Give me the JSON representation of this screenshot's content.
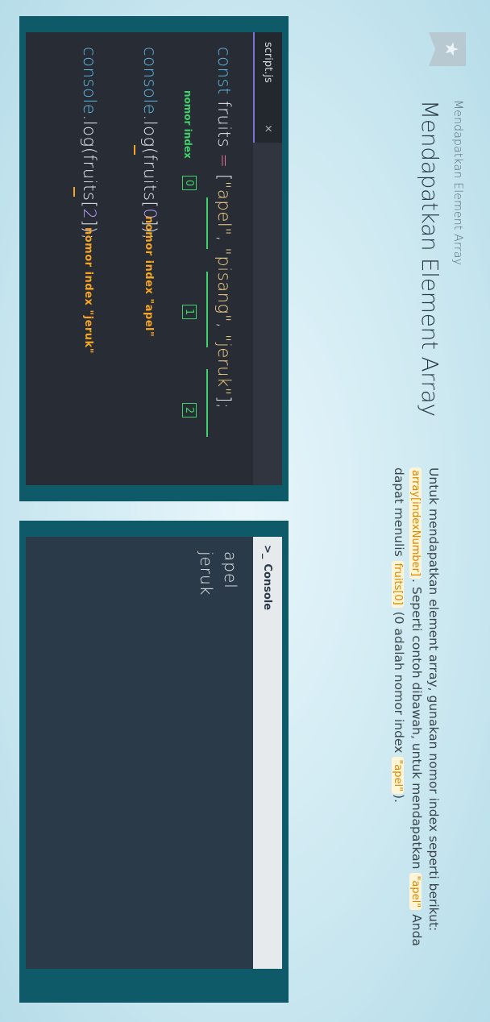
{
  "header": {
    "breadcrumb": "Mendapatkan Element Array",
    "title": "Mendapatkan Element Array"
  },
  "description": {
    "part1": "Untuk mendapatkan element array, gunakan nomor index seperti berikut: ",
    "code1": "array[indexNumber]",
    "part2": ". Seperti contoh dibawah, untuk mendapatkan ",
    "code2": "\"apel\"",
    "part3": " Anda dapat menulis ",
    "code3": "fruits[0]",
    "part4": " (0 adalah nomor index ",
    "code4": "\"apel\"",
    "part5": ")."
  },
  "editor": {
    "tab_label": "script.js",
    "tab_close": "×",
    "line1": {
      "kw": "const",
      "ident": " fruits ",
      "op": "=",
      "open": " [",
      "s1": "\"apel\"",
      "c1": ", ",
      "s2": "\"pisang\"",
      "c2": ", ",
      "s3": "\"jeruk\"",
      "close": "];"
    },
    "line2": {
      "obj": "console",
      "method": ".log(fruits[",
      "idx": "0",
      "end": "]);"
    },
    "line3": {
      "obj": "console",
      "method": ".log(fruits[",
      "idx": "2",
      "end": "]);"
    },
    "index_label": "nomor index",
    "index_boxes": [
      "0",
      "1",
      "2"
    ],
    "annotation_apel": "nomor index \"apel\"",
    "annotation_jeruk": "nomor index \"jeruk\""
  },
  "console": {
    "icon": ">_",
    "title": "Console",
    "output": [
      "apel",
      "jeruk"
    ]
  },
  "colors": {
    "frame": "#0e5a68",
    "editor_bg": "#282c34",
    "console_bg": "#2b3a48",
    "highlight_green": "#3fd16a",
    "highlight_orange": "#f6a623"
  },
  "icons": {
    "bookmark": "star-bookmark-icon"
  }
}
